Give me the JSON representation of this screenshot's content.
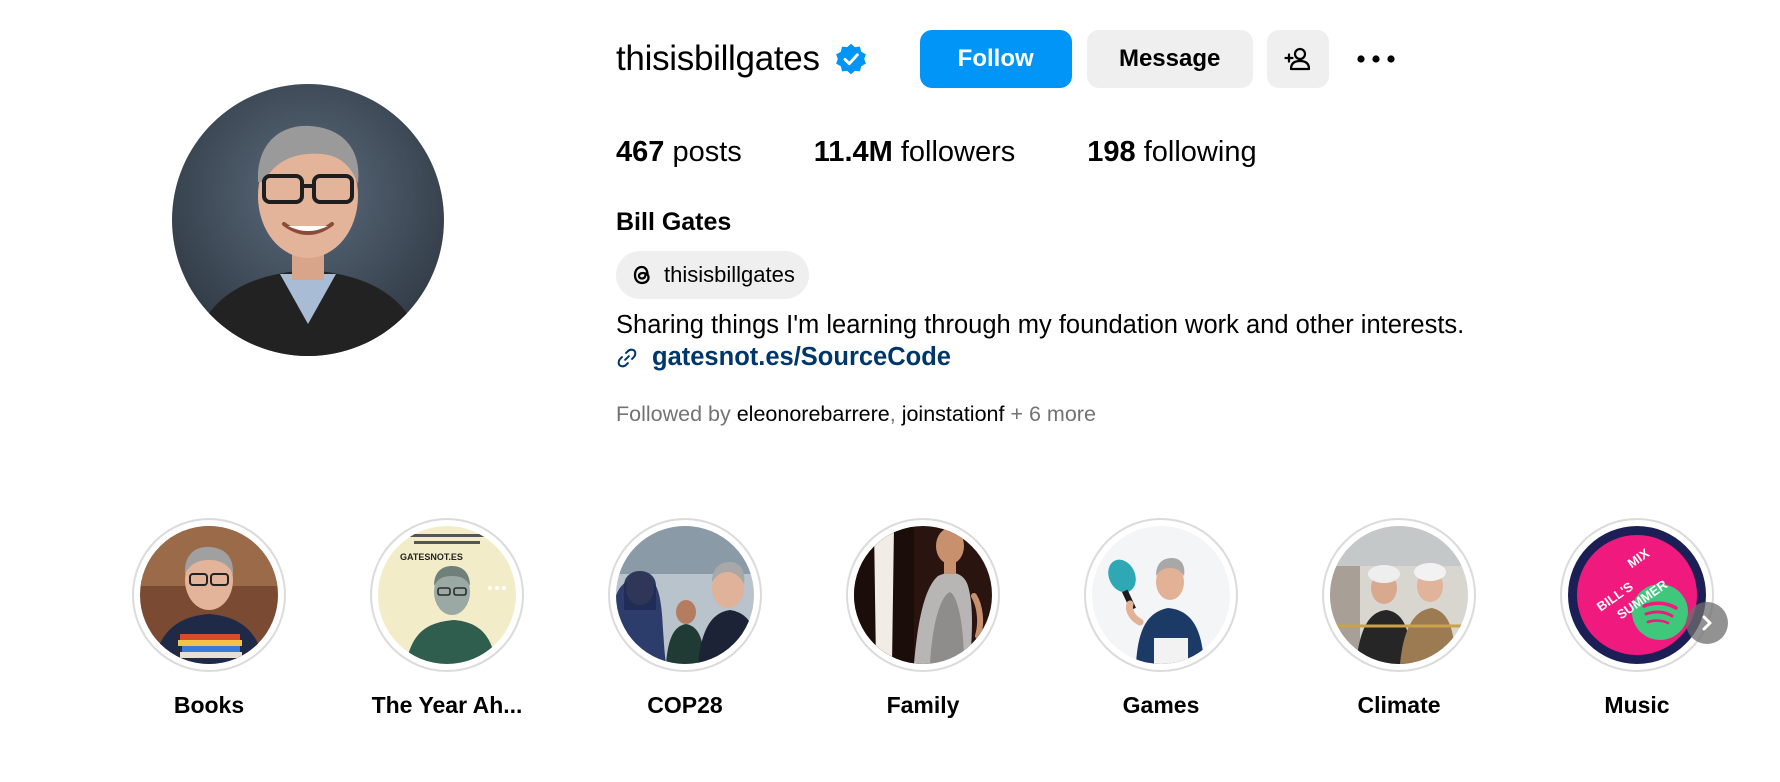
{
  "profile": {
    "username": "thisisbillgates",
    "full_name": "Bill Gates",
    "verified_icon": "verified-badge-icon",
    "accent_color": "#0095f6"
  },
  "actions": {
    "follow_label": "Follow",
    "message_label": "Message",
    "suggest_icon": "add-person-icon",
    "more_icon": "more-options-icon"
  },
  "stats": {
    "posts_count": "467",
    "posts_label": "posts",
    "followers_count": "11.4M",
    "followers_label": "followers",
    "following_count": "198",
    "following_label": "following"
  },
  "threads": {
    "handle": "thisisbillgates",
    "icon": "threads-icon"
  },
  "bio": {
    "text": "Sharing things I'm learning through my foundation work and other interests.",
    "link_text": "gatesnot.es/SourceCode",
    "link_icon": "link-icon",
    "link_color": "#00376b"
  },
  "followed_by": {
    "prefix": "Followed by",
    "user1": "eleonorebarrere",
    "separator": ",",
    "user2": "joinstationf",
    "suffix": "+ 6 more"
  },
  "highlights": [
    {
      "label": "Books"
    },
    {
      "label": "The Year Ah..."
    },
    {
      "label": "COP28"
    },
    {
      "label": "Family"
    },
    {
      "label": "Games"
    },
    {
      "label": "Climate"
    },
    {
      "label": "Music",
      "cover_text_1": "BILL'S",
      "cover_text_2": "SUMMER",
      "cover_text_3": "MIX"
    }
  ],
  "highlight_cover_text": {
    "year_ahead_caption": "GATESNOT.ES"
  },
  "highlights_next_icon": "chevron-right-icon"
}
